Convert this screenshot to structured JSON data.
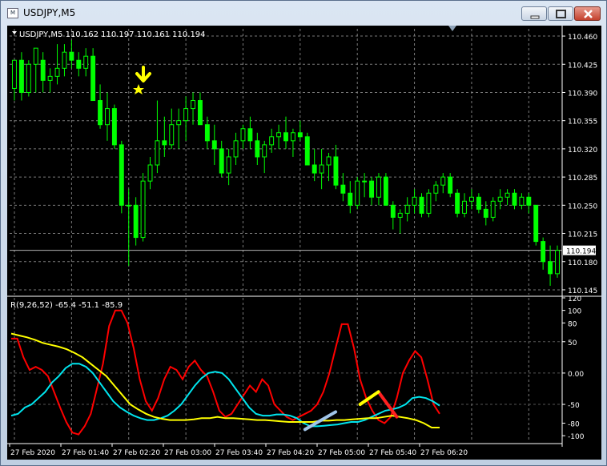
{
  "window": {
    "title": "USDJPY,M5",
    "icon": "chart-window-icon",
    "buttons": [
      "minimize-icon",
      "maximize-icon",
      "close-icon"
    ]
  },
  "header": {
    "symbol_info": "USDJPY,M5  110.162 110.197 110.161 110.194",
    "collapse_icon": "triangle-down-icon"
  },
  "annotations": {
    "arrow_icon": "down-arrow-icon",
    "star_icon": "star-icon",
    "arrow_color": "#ffff00"
  },
  "chart_data": [
    {
      "type": "candlestick",
      "symbol": "USDJPY",
      "timeframe": "M5",
      "ylim": [
        110.139,
        110.469
      ],
      "y_ticks": [
        110.46,
        110.425,
        110.39,
        110.355,
        110.32,
        110.285,
        110.25,
        110.215,
        110.18,
        110.145
      ],
      "current_price": 110.194,
      "grid": true,
      "bull_color": "#ffffff",
      "bear_color": "#00ff00",
      "candles": [
        {
          "o": 110.395,
          "h": 110.43,
          "l": 110.38,
          "c": 110.43
        },
        {
          "o": 110.43,
          "h": 110.44,
          "l": 110.38,
          "c": 110.39
        },
        {
          "o": 110.39,
          "h": 110.43,
          "l": 110.385,
          "c": 110.425
        },
        {
          "o": 110.425,
          "h": 110.445,
          "l": 110.39,
          "c": 110.445
        },
        {
          "o": 110.43,
          "h": 110.44,
          "l": 110.39,
          "c": 110.405
        },
        {
          "o": 110.405,
          "h": 110.42,
          "l": 110.39,
          "c": 110.41
        },
        {
          "o": 110.41,
          "h": 110.45,
          "l": 110.4,
          "c": 110.42
        },
        {
          "o": 110.42,
          "h": 110.45,
          "l": 110.41,
          "c": 110.44
        },
        {
          "o": 110.44,
          "h": 110.455,
          "l": 110.42,
          "c": 110.43
        },
        {
          "o": 110.43,
          "h": 110.44,
          "l": 110.41,
          "c": 110.42
        },
        {
          "o": 110.42,
          "h": 110.445,
          "l": 110.41,
          "c": 110.435
        },
        {
          "o": 110.435,
          "h": 110.445,
          "l": 110.38,
          "c": 110.38
        },
        {
          "o": 110.38,
          "h": 110.4,
          "l": 110.345,
          "c": 110.35
        },
        {
          "o": 110.35,
          "h": 110.39,
          "l": 110.33,
          "c": 110.37
        },
        {
          "o": 110.37,
          "h": 110.375,
          "l": 110.32,
          "c": 110.325
        },
        {
          "o": 110.325,
          "h": 110.33,
          "l": 110.24,
          "c": 110.25
        },
        {
          "o": 110.25,
          "h": 110.27,
          "l": 110.175,
          "c": 110.25
        },
        {
          "o": 110.25,
          "h": 110.26,
          "l": 110.2,
          "c": 110.21
        },
        {
          "o": 110.21,
          "h": 110.29,
          "l": 110.205,
          "c": 110.28
        },
        {
          "o": 110.28,
          "h": 110.31,
          "l": 110.27,
          "c": 110.3
        },
        {
          "o": 110.3,
          "h": 110.38,
          "l": 110.29,
          "c": 110.33
        },
        {
          "o": 110.33,
          "h": 110.36,
          "l": 110.31,
          "c": 110.325
        },
        {
          "o": 110.325,
          "h": 110.37,
          "l": 110.32,
          "c": 110.35
        },
        {
          "o": 110.35,
          "h": 110.37,
          "l": 110.32,
          "c": 110.355
        },
        {
          "o": 110.355,
          "h": 110.385,
          "l": 110.33,
          "c": 110.37
        },
        {
          "o": 110.37,
          "h": 110.39,
          "l": 110.35,
          "c": 110.38
        },
        {
          "o": 110.38,
          "h": 110.39,
          "l": 110.35,
          "c": 110.35
        },
        {
          "o": 110.35,
          "h": 110.36,
          "l": 110.32,
          "c": 110.33
        },
        {
          "o": 110.33,
          "h": 110.35,
          "l": 110.3,
          "c": 110.32
        },
        {
          "o": 110.32,
          "h": 110.33,
          "l": 110.285,
          "c": 110.29
        },
        {
          "o": 110.29,
          "h": 110.32,
          "l": 110.275,
          "c": 110.31
        },
        {
          "o": 110.31,
          "h": 110.34,
          "l": 110.3,
          "c": 110.33
        },
        {
          "o": 110.33,
          "h": 110.35,
          "l": 110.32,
          "c": 110.345
        },
        {
          "o": 110.345,
          "h": 110.36,
          "l": 110.32,
          "c": 110.33
        },
        {
          "o": 110.33,
          "h": 110.34,
          "l": 110.3,
          "c": 110.31
        },
        {
          "o": 110.31,
          "h": 110.33,
          "l": 110.29,
          "c": 110.325
        },
        {
          "o": 110.325,
          "h": 110.345,
          "l": 110.315,
          "c": 110.335
        },
        {
          "o": 110.335,
          "h": 110.35,
          "l": 110.32,
          "c": 110.34
        },
        {
          "o": 110.34,
          "h": 110.36,
          "l": 110.32,
          "c": 110.33
        },
        {
          "o": 110.33,
          "h": 110.345,
          "l": 110.31,
          "c": 110.34
        },
        {
          "o": 110.34,
          "h": 110.355,
          "l": 110.33,
          "c": 110.335
        },
        {
          "o": 110.335,
          "h": 110.34,
          "l": 110.3,
          "c": 110.3
        },
        {
          "o": 110.3,
          "h": 110.32,
          "l": 110.28,
          "c": 110.29
        },
        {
          "o": 110.29,
          "h": 110.32,
          "l": 110.27,
          "c": 110.3
        },
        {
          "o": 110.3,
          "h": 110.315,
          "l": 110.28,
          "c": 110.31
        },
        {
          "o": 110.31,
          "h": 110.325,
          "l": 110.27,
          "c": 110.275
        },
        {
          "o": 110.275,
          "h": 110.29,
          "l": 110.255,
          "c": 110.265
        },
        {
          "o": 110.265,
          "h": 110.28,
          "l": 110.24,
          "c": 110.25
        },
        {
          "o": 110.25,
          "h": 110.285,
          "l": 110.245,
          "c": 110.28
        },
        {
          "o": 110.28,
          "h": 110.29,
          "l": 110.26,
          "c": 110.28
        },
        {
          "o": 110.28,
          "h": 110.285,
          "l": 110.25,
          "c": 110.26
        },
        {
          "o": 110.26,
          "h": 110.29,
          "l": 110.25,
          "c": 110.285
        },
        {
          "o": 110.285,
          "h": 110.29,
          "l": 110.25,
          "c": 110.25
        },
        {
          "o": 110.25,
          "h": 110.255,
          "l": 110.22,
          "c": 110.235
        },
        {
          "o": 110.235,
          "h": 110.245,
          "l": 110.215,
          "c": 110.24
        },
        {
          "o": 110.24,
          "h": 110.26,
          "l": 110.23,
          "c": 110.25
        },
        {
          "o": 110.25,
          "h": 110.27,
          "l": 110.24,
          "c": 110.26
        },
        {
          "o": 110.26,
          "h": 110.265,
          "l": 110.235,
          "c": 110.24
        },
        {
          "o": 110.24,
          "h": 110.27,
          "l": 110.235,
          "c": 110.265
        },
        {
          "o": 110.265,
          "h": 110.28,
          "l": 110.255,
          "c": 110.275
        },
        {
          "o": 110.275,
          "h": 110.29,
          "l": 110.265,
          "c": 110.285
        },
        {
          "o": 110.285,
          "h": 110.29,
          "l": 110.26,
          "c": 110.265
        },
        {
          "o": 110.265,
          "h": 110.27,
          "l": 110.235,
          "c": 110.24
        },
        {
          "o": 110.24,
          "h": 110.265,
          "l": 110.235,
          "c": 110.255
        },
        {
          "o": 110.255,
          "h": 110.27,
          "l": 110.245,
          "c": 110.26
        },
        {
          "o": 110.26,
          "h": 110.265,
          "l": 110.24,
          "c": 110.245
        },
        {
          "o": 110.245,
          "h": 110.255,
          "l": 110.225,
          "c": 110.235
        },
        {
          "o": 110.235,
          "h": 110.26,
          "l": 110.23,
          "c": 110.255
        },
        {
          "o": 110.255,
          "h": 110.27,
          "l": 110.245,
          "c": 110.26
        },
        {
          "o": 110.26,
          "h": 110.27,
          "l": 110.25,
          "c": 110.265
        },
        {
          "o": 110.265,
          "h": 110.27,
          "l": 110.245,
          "c": 110.25
        },
        {
          "o": 110.25,
          "h": 110.265,
          "l": 110.245,
          "c": 110.26
        },
        {
          "o": 110.26,
          "h": 110.265,
          "l": 110.24,
          "c": 110.25
        },
        {
          "o": 110.25,
          "h": 110.25,
          "l": 110.2,
          "c": 110.205
        },
        {
          "o": 110.205,
          "h": 110.21,
          "l": 110.17,
          "c": 110.18
        },
        {
          "o": 110.18,
          "h": 110.2,
          "l": 110.15,
          "c": 110.165
        },
        {
          "o": 110.165,
          "h": 110.2,
          "l": 110.16,
          "c": 110.194
        }
      ]
    },
    {
      "type": "line",
      "indicator_label": "R(9,26,52) -65.4 -51.1 -85.9",
      "ylim": [
        -110,
        120
      ],
      "y_ticks": [
        120,
        100,
        80,
        50,
        0,
        -50,
        -80,
        -100
      ],
      "y_tick_labels": [
        "120",
        "100",
        "80",
        "50",
        "0.00",
        "-50",
        "-80",
        "-100"
      ],
      "colors": [
        "#ff0000",
        "#00e5ee",
        "#ffff00"
      ],
      "series": [
        {
          "values": [
            55,
            55,
            25,
            5,
            10,
            5,
            -5,
            -30,
            -55,
            -78,
            -95,
            -98,
            -85,
            -65,
            -25,
            15,
            75,
            100,
            100,
            80,
            40,
            -10,
            -45,
            -60,
            -40,
            -10,
            10,
            5,
            -10,
            10,
            20,
            5,
            -5,
            -30,
            -60,
            -70,
            -65,
            -50,
            -35,
            -20,
            -30,
            -10,
            -20,
            -50,
            -60,
            -70,
            -75,
            -70,
            -65,
            -60,
            -50,
            -30,
            0,
            40,
            78,
            78,
            40,
            -10,
            -40,
            -60,
            -75,
            -80,
            -70,
            -40,
            0,
            20,
            35,
            25,
            -10,
            -50,
            -65
          ]
        },
        {
          "values": [
            -68,
            -65,
            -55,
            -50,
            -40,
            -30,
            -15,
            -5,
            8,
            15,
            15,
            10,
            0,
            -15,
            -30,
            -45,
            -55,
            -62,
            -68,
            -72,
            -75,
            -75,
            -72,
            -68,
            -60,
            -50,
            -35,
            -20,
            -8,
            0,
            2,
            0,
            -10,
            -25,
            -40,
            -55,
            -65,
            -68,
            -68,
            -66,
            -66,
            -68,
            -72,
            -80,
            -85,
            -85,
            -84,
            -83,
            -82,
            -80,
            -78,
            -78,
            -75,
            -70,
            -65,
            -60,
            -58,
            -55,
            -50,
            -40,
            -38,
            -40,
            -45,
            -52
          ]
        },
        {
          "values": [
            63,
            60,
            57,
            53,
            48,
            45,
            42,
            38,
            32,
            25,
            15,
            5,
            -5,
            -20,
            -35,
            -50,
            -58,
            -65,
            -70,
            -73,
            -75,
            -75,
            -75,
            -74,
            -72,
            -72,
            -70,
            -72,
            -72,
            -73,
            -74,
            -75,
            -75,
            -76,
            -77,
            -78,
            -78,
            -78,
            -78,
            -76,
            -76,
            -75,
            -75,
            -74,
            -73,
            -72,
            -72,
            -70,
            -68,
            -70,
            -72,
            -75,
            -80,
            -87,
            -87
          ]
        }
      ],
      "time_labels": [
        "27 Feb 2020",
        "27 Feb 01:40",
        "27 Feb 02:20",
        "27 Feb 03:00",
        "27 Feb 03:40",
        "27 Feb 04:20",
        "27 Feb 05:00",
        "27 Feb 05:40",
        "27 Feb 06:20"
      ],
      "drawn_segments": [
        {
          "color": "#ff2020",
          "from": [
            -70,
            63
          ],
          "to": [
            -30,
            60
          ]
        },
        {
          "color": "#ffff00",
          "from": [
            -30,
            60
          ],
          "to": [
            -50,
            57
          ]
        },
        {
          "color": "#a0c4e8",
          "from": [
            -62,
            53
          ],
          "to": [
            -90,
            48
          ]
        }
      ]
    }
  ]
}
